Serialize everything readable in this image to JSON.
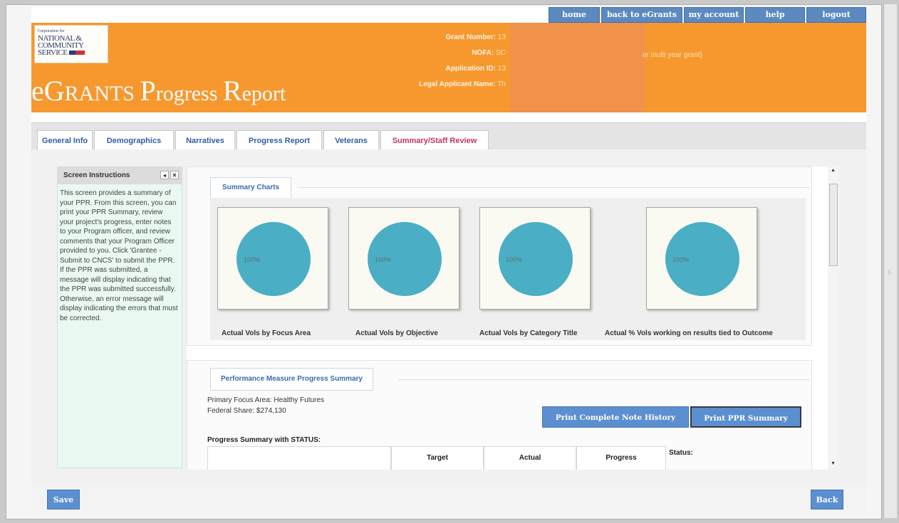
{
  "topnav": [
    "home",
    "back to eGrants",
    "my account",
    "help",
    "logout"
  ],
  "logo": {
    "line1": "Corporation for",
    "line2": "NATIONAL &",
    "line3": "COMMUNITY",
    "line4": "SERVICE"
  },
  "header": {
    "title_big1": "eG",
    "title_small1": "RANTS ",
    "title_big2": "P",
    "title_small2": "rogress ",
    "title_big3": "R",
    "title_small3": "eport",
    "grant_label": "Grant Number:",
    "grant_value": "13",
    "nofa_label": "NOFA:",
    "nofa_value": "SC",
    "appid_label": "Application ID:",
    "appid_value": "13",
    "legal_label": "Legal Applicant Name:",
    "legal_value": "Th",
    "multi_year": "or multi year grant)"
  },
  "tabs": [
    "General Info",
    "Demographics",
    "Narratives",
    "Progress Report",
    "Veterans",
    "Summary/Staff Review"
  ],
  "instructions": {
    "title": "Screen Instructions",
    "text": "This screen provides a summary of your PPR. From this screen, you can print your PPR Summary, review your project's progress, enter notes to your Program officer, and review comments that your Program Officer provided to you. Click 'Grantee - Submit to CNCS' to submit the PPR. If the PPR was submitted, a message will display indicating that the PPR was submitted successfully. Otherwise, an error message will display indicating the errors that must be corrected."
  },
  "summary": {
    "legend": "Summary Charts",
    "charts": [
      {
        "title": "Actual Vols by Focus Area",
        "label": "100%"
      },
      {
        "title": "Actual Vols by Objective",
        "label": "100%"
      },
      {
        "title": "Actual Vols by Category Title",
        "label": "100%"
      },
      {
        "title": "Actual % Vols working on results tied to Outcome",
        "label": "100%"
      }
    ]
  },
  "chart_data": [
    {
      "type": "pie",
      "title": "Actual Vols by Focus Area",
      "values": [
        100
      ],
      "labels": [
        "100%"
      ],
      "colors": [
        "#4aaec4"
      ]
    },
    {
      "type": "pie",
      "title": "Actual Vols by Objective",
      "values": [
        100
      ],
      "labels": [
        "100%"
      ],
      "colors": [
        "#4aaec4"
      ]
    },
    {
      "type": "pie",
      "title": "Actual Vols by Category Title",
      "values": [
        100
      ],
      "labels": [
        "100%"
      ],
      "colors": [
        "#4aaec4"
      ]
    },
    {
      "type": "pie",
      "title": "Actual % Vols working on results tied to Outcome",
      "values": [
        100
      ],
      "labels": [
        "100%"
      ],
      "colors": [
        "#4aaec4"
      ]
    }
  ],
  "pm": {
    "legend": "Performance Measure Progress Summary",
    "focus_area": "Primary Focus Area: Healthy Futures",
    "federal_share": "Federal Share: $274,130",
    "print_history": "Print Complete Note History",
    "print_summary": "Print PPR Summary",
    "progress_title": "Progress Summary with STATUS:",
    "columns": [
      "",
      "Target",
      "Actual",
      "Progress",
      "Status:"
    ]
  },
  "buttons": {
    "save": "Save",
    "back": "Back"
  },
  "colors": {
    "header": "#f7982f",
    "nav": "#5b89c0",
    "button": "#5b8fd0",
    "pie": "#4aaec4",
    "active_tab": "#c2336b"
  }
}
